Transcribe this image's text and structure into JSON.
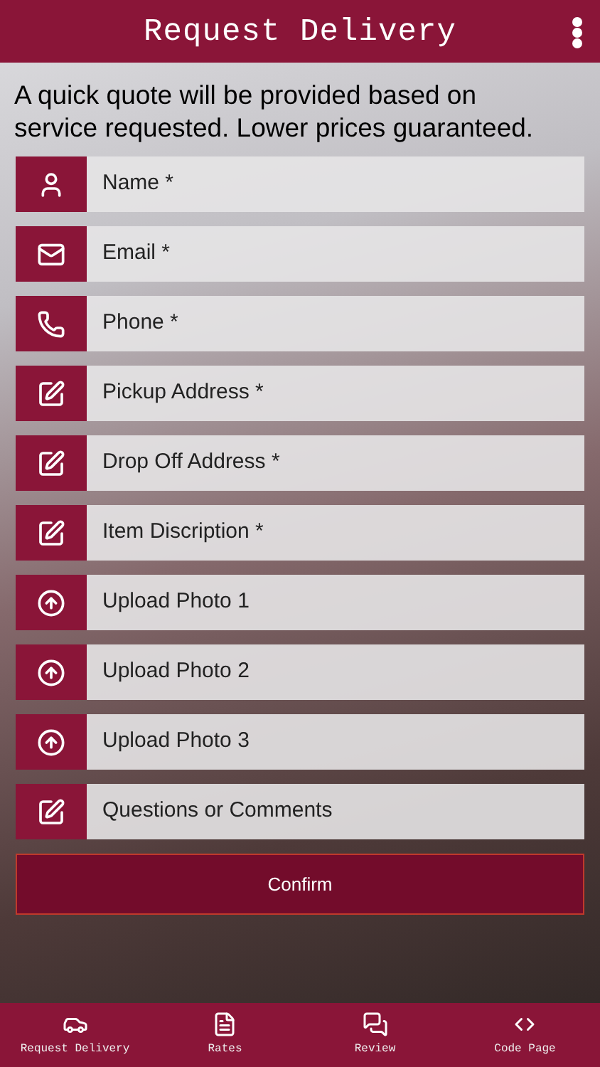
{
  "header": {
    "title": "Request Delivery"
  },
  "intro": "A quick quote will be provided based on service requested. Lower prices guaranteed.",
  "fields": [
    {
      "kind": "person",
      "placeholder": "Name *"
    },
    {
      "kind": "mail",
      "placeholder": "Email *"
    },
    {
      "kind": "phone",
      "placeholder": "Phone *"
    },
    {
      "kind": "edit",
      "placeholder": "Pickup Address *"
    },
    {
      "kind": "edit",
      "placeholder": "Drop Off Address *"
    },
    {
      "kind": "edit",
      "placeholder": "Item Discription *"
    },
    {
      "kind": "upload",
      "placeholder": "Upload Photo 1"
    },
    {
      "kind": "upload",
      "placeholder": "Upload Photo 2"
    },
    {
      "kind": "upload",
      "placeholder": "Upload Photo 3"
    },
    {
      "kind": "edit",
      "placeholder": "Questions or Comments"
    }
  ],
  "confirm_button": "Confirm",
  "bottom_nav": [
    {
      "kind": "cars",
      "label": "Request Delivery"
    },
    {
      "kind": "file",
      "label": "Rates"
    },
    {
      "kind": "chat",
      "label": "Review"
    },
    {
      "kind": "code",
      "label": "Code Page"
    }
  ]
}
